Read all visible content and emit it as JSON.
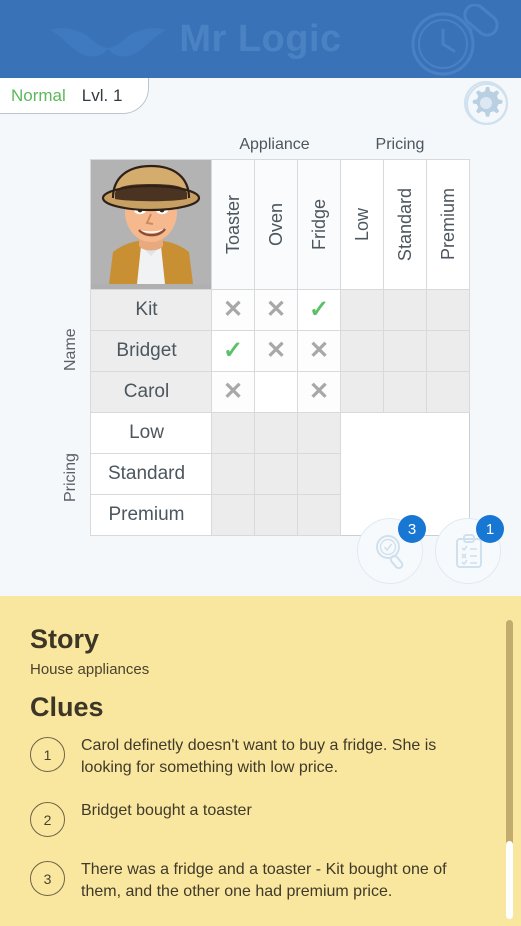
{
  "header": {
    "title": "Mr Logic",
    "mustache_icon": "mustache-icon",
    "magnifier_icon": "magnifying-glass-icon"
  },
  "level_bar": {
    "difficulty": "Normal",
    "level": "Lvl. 1",
    "settings_icon": "gear-icon"
  },
  "grid": {
    "column_groups": [
      {
        "label": "Appliance"
      },
      {
        "label": "Pricing"
      }
    ],
    "column_headers": [
      "Toaster",
      "Oven",
      "Fridge",
      "Low",
      "Standard",
      "Premium"
    ],
    "row_axis_labels": [
      "Name",
      "Pricing"
    ],
    "name_rows": [
      {
        "label": "Kit",
        "cells": [
          "x",
          "x",
          "v",
          "",
          "",
          ""
        ]
      },
      {
        "label": "Bridget",
        "cells": [
          "v",
          "x",
          "x",
          "",
          "",
          ""
        ]
      },
      {
        "label": "Carol",
        "cells": [
          "x",
          "",
          "x",
          "",
          "",
          ""
        ]
      }
    ],
    "price_rows": [
      {
        "label": "Low",
        "cells": [
          "",
          "",
          ""
        ]
      },
      {
        "label": "Standard",
        "cells": [
          "",
          "",
          ""
        ]
      },
      {
        "label": "Premium",
        "cells": [
          "",
          "",
          ""
        ]
      }
    ],
    "mark_glyphs": {
      "x": "✕",
      "v": "✓"
    },
    "avatar": "detective-avatar"
  },
  "tools": [
    {
      "name": "hint-button",
      "icon": "magnifier-check-icon",
      "badge": "3"
    },
    {
      "name": "notes-button",
      "icon": "clipboard-icon",
      "badge": "1"
    }
  ],
  "story": {
    "story_heading": "Story",
    "story_text": "House appliances",
    "clues_heading": "Clues",
    "clues": [
      {
        "num": "1",
        "text": "Carol definetly doesn't want to buy a fridge. She is looking for something with low price."
      },
      {
        "num": "2",
        "text": "Bridget bought a toaster"
      },
      {
        "num": "3",
        "text": "There was a fridge and a toaster - Kit bought one of them, and the other one had premium price."
      }
    ]
  },
  "colors": {
    "header_blue": "#3a72b8",
    "accent_blue": "#1977d4",
    "check_green": "#5cc16a",
    "cross_gray": "#a8a8a8",
    "story_bg": "#fae79f"
  }
}
